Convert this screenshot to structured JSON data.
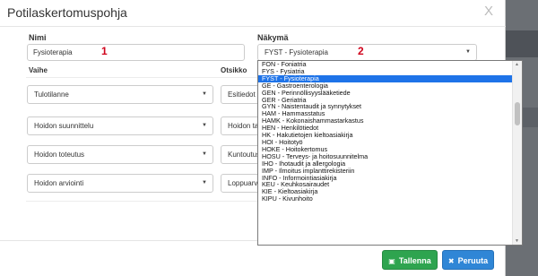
{
  "modal": {
    "title": "Potilaskertomuspohja",
    "close_label": "X"
  },
  "form": {
    "nimi_label": "Nimi",
    "nimi_value": "Fysioterapia",
    "nakyma_label": "Näkymä",
    "nakyma_value": "FYST - Fysioterapia",
    "annotation_1": "1",
    "annotation_2": "2",
    "vaihe_header": "Vaihe",
    "otsikko_header": "Otsikko",
    "rows": [
      {
        "vaihe": "Tulotilanne",
        "otsikko": "Esitiedot"
      },
      {
        "vaihe": "Hoidon suunnittelu",
        "otsikko": "Hoidon ta"
      },
      {
        "vaihe": "Hoidon toteutus",
        "otsikko": "Kuntoutus"
      },
      {
        "vaihe": "Hoidon arviointi",
        "otsikko": "Loppuarv"
      }
    ]
  },
  "dropdown": {
    "options": [
      "FON - Foniatria",
      "FYS - Fysiatria",
      "FYST - Fysioterapia",
      "GE - Gastroenterologia",
      "GEN - Perinnöllisyyslääketiede",
      "GER - Geriatria",
      "GYN - Naistentaudit ja synnytykset",
      "HAM - Hammasstatus",
      "HAMK - Kokonaishammastarkastus",
      "HEN - Henkilötiedot",
      "HK - Hakutietojen kieltoasiakirja",
      "HOI - Hoitotyö",
      "HOKE - Hoitokertomus",
      "HOSU - Terveys- ja hoitosuunnitelma",
      "IHO - Ihotaudit ja allergologia",
      "IMP - Ilmoitus implanttirekisteriin",
      "INFO - Informointiasiakirja",
      "KEU - Keuhkosairaudet",
      "KIE - Kieltoasiakirja",
      "KIPU - Kivunhoito"
    ],
    "selected_index": 2
  },
  "footer": {
    "save_label": "Tallenna",
    "cancel_label": "Peruuta"
  },
  "colors": {
    "selected": "#1e73e8",
    "save": "#2ea44f",
    "cancel": "#2f86d6",
    "annotation": "#d0021b"
  }
}
